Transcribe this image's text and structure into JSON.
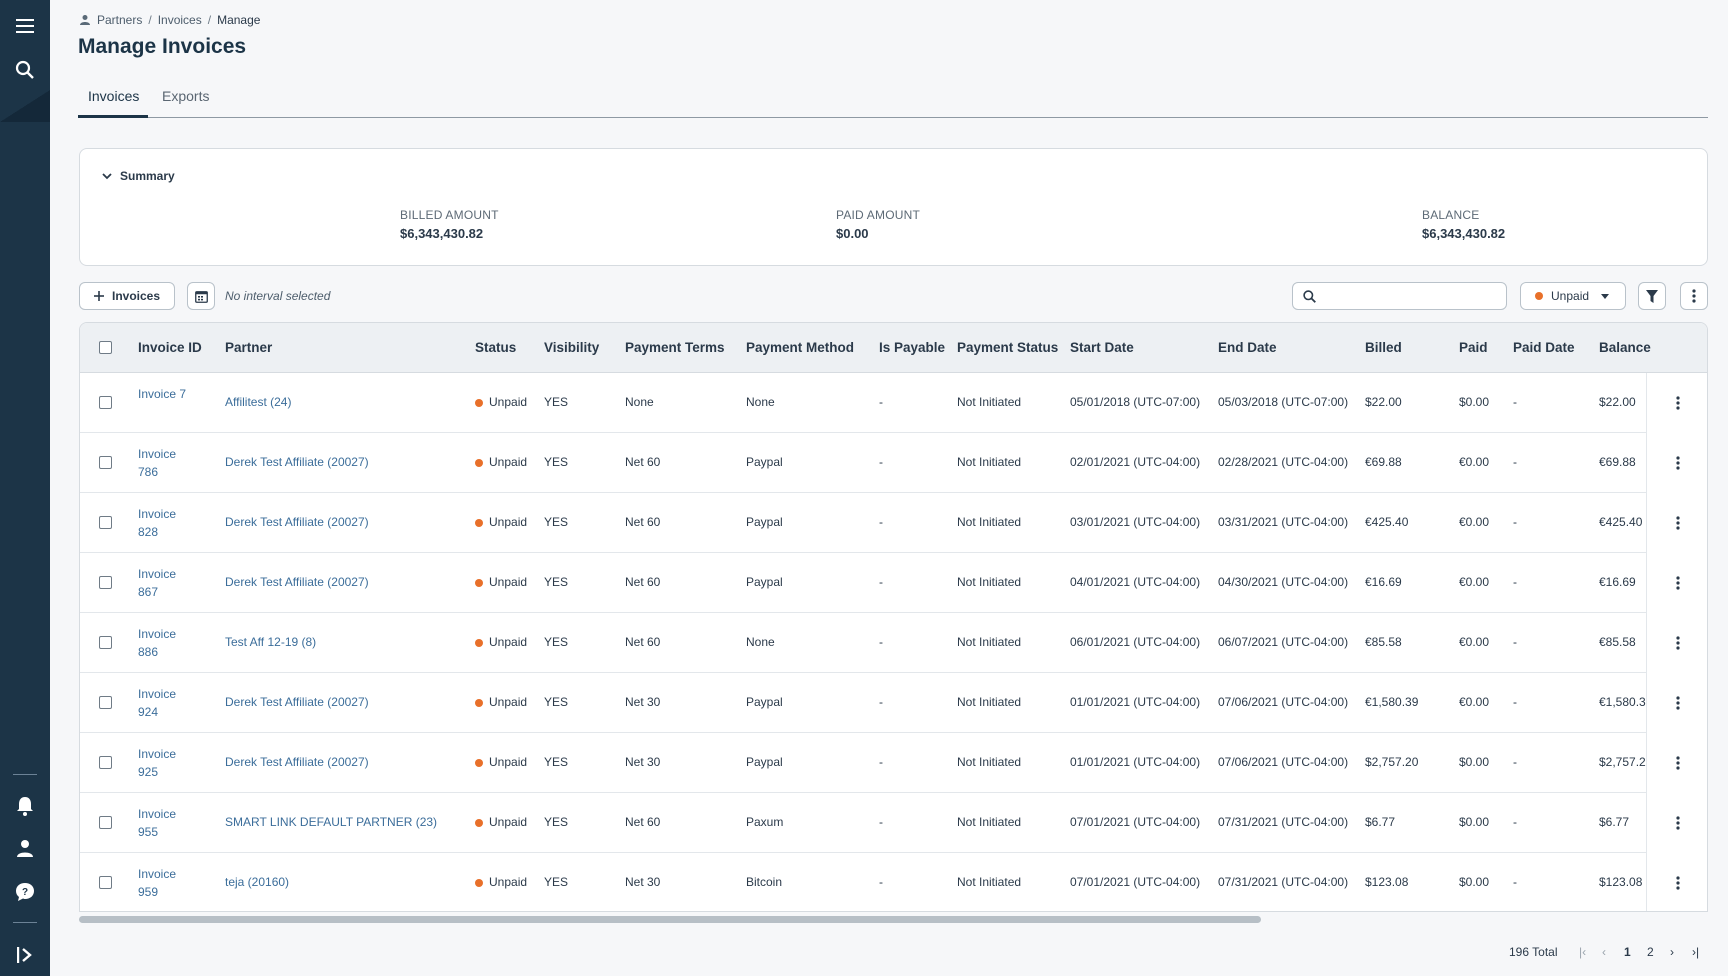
{
  "breadcrumb": {
    "items": [
      "Partners",
      "Invoices",
      "Manage"
    ],
    "sep": "/"
  },
  "page_title": "Manage Invoices",
  "tabs": [
    {
      "label": "Invoices"
    },
    {
      "label": "Exports"
    }
  ],
  "summary": {
    "toggle_label": "Summary",
    "stats": [
      {
        "label": "BILLED AMOUNT",
        "value": "$6,343,430.82"
      },
      {
        "label": "PAID AMOUNT",
        "value": "$0.00"
      },
      {
        "label": "BALANCE",
        "value": "$6,343,430.82"
      }
    ]
  },
  "toolbar": {
    "add_label": "Invoices",
    "interval_text": "No interval selected",
    "search_placeholder": "",
    "status_filter": "Unpaid"
  },
  "table": {
    "headers": [
      "Invoice ID",
      "Partner",
      "Status",
      "Visibility",
      "Payment Terms",
      "Payment Method",
      "Is Payable",
      "Payment Status",
      "Start Date",
      "End Date",
      "Billed",
      "Paid",
      "Paid Date",
      "Balance"
    ],
    "rows": [
      [
        "Invoice 7",
        "Affilitest (24)",
        "Unpaid",
        "YES",
        "None",
        "None",
        "-",
        "Not Initiated",
        "05/01/2018 (UTC-07:00)",
        "05/03/2018 (UTC-07:00)",
        "$22.00",
        "$0.00",
        "-",
        "$22.00"
      ],
      [
        "Invoice 786",
        "Derek Test Affiliate (20027)",
        "Unpaid",
        "YES",
        "Net 60",
        "Paypal",
        "-",
        "Not Initiated",
        "02/01/2021 (UTC-04:00)",
        "02/28/2021 (UTC-04:00)",
        "€69.88",
        "€0.00",
        "-",
        "€69.88"
      ],
      [
        "Invoice 828",
        "Derek Test Affiliate (20027)",
        "Unpaid",
        "YES",
        "Net 60",
        "Paypal",
        "-",
        "Not Initiated",
        "03/01/2021 (UTC-04:00)",
        "03/31/2021 (UTC-04:00)",
        "€425.40",
        "€0.00",
        "-",
        "€425.40"
      ],
      [
        "Invoice 867",
        "Derek Test Affiliate (20027)",
        "Unpaid",
        "YES",
        "Net 60",
        "Paypal",
        "-",
        "Not Initiated",
        "04/01/2021 (UTC-04:00)",
        "04/30/2021 (UTC-04:00)",
        "€16.69",
        "€0.00",
        "-",
        "€16.69"
      ],
      [
        "Invoice 886",
        "Test Aff 12-19 (8)",
        "Unpaid",
        "YES",
        "Net 60",
        "None",
        "-",
        "Not Initiated",
        "06/01/2021 (UTC-04:00)",
        "06/07/2021 (UTC-04:00)",
        "€85.58",
        "€0.00",
        "-",
        "€85.58"
      ],
      [
        "Invoice 924",
        "Derek Test Affiliate (20027)",
        "Unpaid",
        "YES",
        "Net 30",
        "Paypal",
        "-",
        "Not Initiated",
        "01/01/2021 (UTC-04:00)",
        "07/06/2021 (UTC-04:00)",
        "€1,580.39",
        "€0.00",
        "-",
        "€1,580.3"
      ],
      [
        "Invoice 925",
        "Derek Test Affiliate (20027)",
        "Unpaid",
        "YES",
        "Net 30",
        "Paypal",
        "-",
        "Not Initiated",
        "01/01/2021 (UTC-04:00)",
        "07/06/2021 (UTC-04:00)",
        "$2,757.20",
        "$0.00",
        "-",
        "$2,757.2"
      ],
      [
        "Invoice 955",
        "SMART LINK DEFAULT PARTNER (23)",
        "Unpaid",
        "YES",
        "Net 60",
        "Paxum",
        "-",
        "Not Initiated",
        "07/01/2021 (UTC-04:00)",
        "07/31/2021 (UTC-04:00)",
        "$6.77",
        "$0.00",
        "-",
        "$6.77"
      ],
      [
        "Invoice 959",
        "teja (20160)",
        "Unpaid",
        "YES",
        "Net 30",
        "Bitcoin",
        "-",
        "Not Initiated",
        "07/01/2021 (UTC-04:00)",
        "07/31/2021 (UTC-04:00)",
        "$123.08",
        "$0.00",
        "-",
        "$123.08"
      ]
    ]
  },
  "pagination": {
    "total": "196 Total",
    "pages": [
      "1",
      "2"
    ],
    "current": "1"
  },
  "colors": {
    "sidebar": "#1c3447",
    "link": "#3b6d9a",
    "unpaid_dot": "#e8702a"
  },
  "icons": [
    "menu-icon",
    "search-icon",
    "bell-icon",
    "user-icon",
    "help-icon",
    "expand-icon",
    "partners-icon",
    "chevron-down-icon",
    "plus-icon",
    "calendar-icon",
    "filter-icon",
    "kebab-icon"
  ]
}
